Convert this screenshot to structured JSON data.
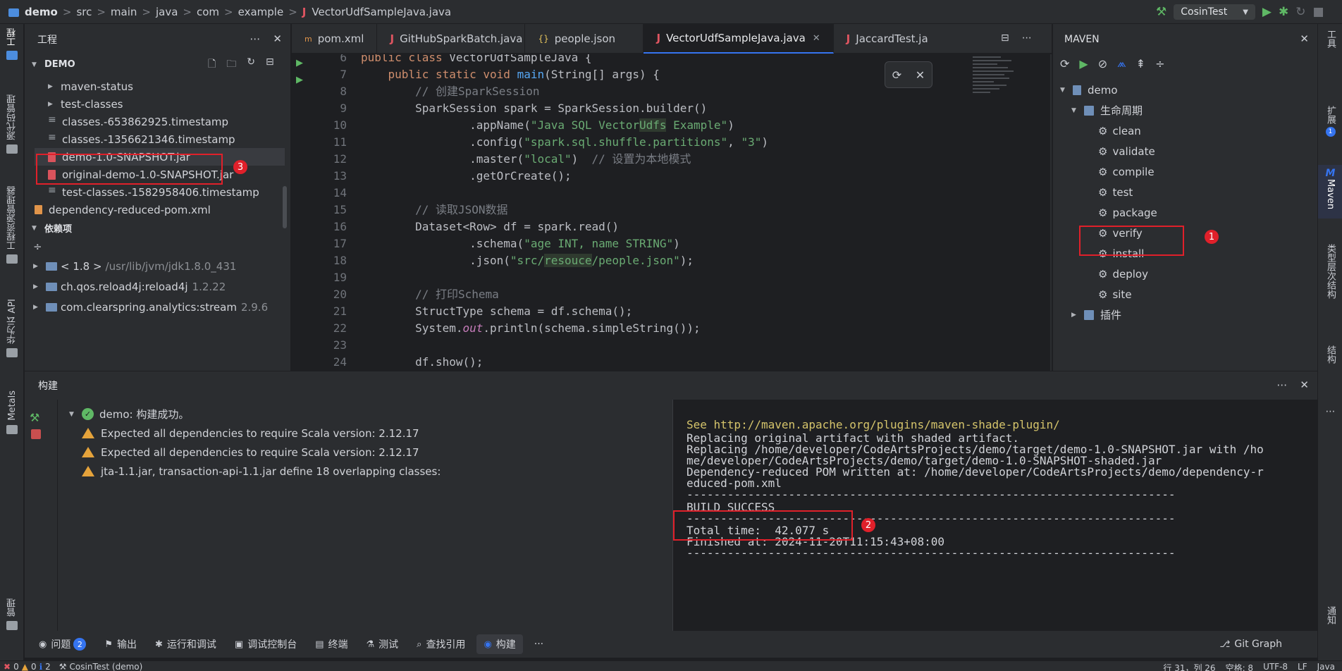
{
  "titlebar": {
    "crumbs": [
      "demo",
      "src",
      "main",
      "java",
      "com",
      "example",
      "VectorUdfSampleJava.java"
    ],
    "run_config": "CosinTest"
  },
  "left_strip": {
    "tabs": [
      "工程",
      "源代码管理",
      "工程资源管理器",
      "华为云 API",
      "Metals",
      "管理"
    ]
  },
  "right_strip": {
    "tabs": [
      "工具",
      "扩展",
      "Maven",
      "类型层次结构",
      "结构",
      "通知"
    ],
    "extension_badge": "1"
  },
  "project": {
    "title": "工程",
    "root": "DEMO",
    "items": [
      {
        "label": "maven-status",
        "kind": "folder"
      },
      {
        "label": "test-classes",
        "kind": "folder"
      },
      {
        "label": "classes.-653862925.timestamp",
        "kind": "file"
      },
      {
        "label": "classes.-1356621346.timestamp",
        "kind": "file"
      },
      {
        "label": "demo-1.0-SNAPSHOT.jar",
        "kind": "jar"
      },
      {
        "label": "original-demo-1.0-SNAPSHOT.jar",
        "kind": "jar"
      },
      {
        "label": "test-classes.-1582958406.timestamp",
        "kind": "file"
      },
      {
        "label": "dependency-reduced-pom.xml",
        "kind": "xml"
      }
    ],
    "deps_title": "依赖项",
    "deps": [
      {
        "label": "< 1.8 >",
        "detail": "/usr/lib/jvm/jdk1.8.0_431"
      },
      {
        "label": "ch.qos.reload4j:reload4j",
        "detail": "1.2.22"
      },
      {
        "label": "com.clearspring.analytics:stream",
        "detail": "2.9.6"
      }
    ]
  },
  "editor": {
    "tabs": [
      "pom.xml",
      "GitHubSparkBatch.java",
      "people.json",
      "VectorUdfSampleJava.java",
      "JaccardTest.ja"
    ],
    "active_tab": "VectorUdfSampleJava.java",
    "lines": [
      {
        "n": "6"
      },
      {
        "n": "7"
      },
      {
        "n": "8"
      },
      {
        "n": "9"
      },
      {
        "n": "10"
      },
      {
        "n": "11"
      },
      {
        "n": "12"
      },
      {
        "n": "13"
      },
      {
        "n": "14"
      },
      {
        "n": "15"
      },
      {
        "n": "16"
      },
      {
        "n": "17"
      },
      {
        "n": "18"
      },
      {
        "n": "19"
      },
      {
        "n": "20"
      },
      {
        "n": "21"
      },
      {
        "n": "22"
      },
      {
        "n": "23"
      },
      {
        "n": "24"
      }
    ],
    "code": {
      "l6a": "public class ",
      "l6b": "VectorUdfSampleJava {",
      "l7a": "    public static void ",
      "l7b": "main",
      "l7c": "(String[] args) {",
      "l8": "        // 创建SparkSession",
      "l9": "        SparkSession spark = SparkSession.builder()",
      "l10a": "                .appName(",
      "l10b": "\"Java SQL Vector",
      "l10c": "Udfs",
      "l10d": " Example\"",
      "l10e": ")",
      "l11a": "                .config(",
      "l11b": "\"spark.sql.shuffle.partitions\"",
      "l11c": ", ",
      "l11d": "\"3\"",
      "l11e": ")",
      "l12a": "                .master(",
      "l12b": "\"local\"",
      "l12c": ")  ",
      "l12d": "// 设置为本地模式",
      "l13": "                .getOrCreate();",
      "l15": "        // 读取JSON数据",
      "l16": "        Dataset<Row> df = spark.read()",
      "l17a": "                .schema(",
      "l17b": "\"age INT, name STRING\"",
      "l17c": ")",
      "l18a": "                .json(",
      "l18b": "\"src/",
      "l18c": "resouce",
      "l18d": "/people.json\"",
      "l18e": ");",
      "l20": "        // 打印Schema",
      "l21": "        StructType schema = df.schema();",
      "l22a": "        System.",
      "l22b": "out",
      "l22c": ".println(schema.simpleString());",
      "l24": "        df.show();"
    }
  },
  "maven": {
    "title": "MAVEN",
    "project": "demo",
    "lifecycle": "生命周期",
    "phases": [
      "clean",
      "validate",
      "compile",
      "test",
      "package",
      "verify",
      "install",
      "deploy",
      "site"
    ],
    "plugins": "插件"
  },
  "build": {
    "title": "构建",
    "status": "demo: 构建成功。",
    "warnings": [
      "Expected all dependencies to require Scala version: 2.12.17",
      "Expected all dependencies to require Scala version: 2.12.17",
      "jta-1.1.jar, transaction-api-1.1.jar define 18 overlapping classes:"
    ],
    "console": [
      "See http://maven.apache.org/plugins/maven-shade-plugin/",
      "Replacing original artifact with shaded artifact.",
      "Replacing /home/developer/CodeArtsProjects/demo/target/demo-1.0-SNAPSHOT.jar with /ho",
      "me/developer/CodeArtsProjects/demo/target/demo-1.0-SNAPSHOT-shaded.jar",
      "Dependency-reduced POM written at: /home/developer/CodeArtsProjects/demo/dependency-r",
      "educed-pom.xml",
      "------------------------------------------------------------------------",
      "BUILD SUCCESS",
      "------------------------------------------------------------------------",
      "Total time:  42.077 s",
      "Finished at: 2024-11-20T11:15:43+08:00",
      "------------------------------------------------------------------------"
    ]
  },
  "bottom_tabs": {
    "items": [
      "问题",
      "输出",
      "运行和调试",
      "调试控制台",
      "终端",
      "测试",
      "查找引用",
      "构建"
    ],
    "problems_count": "2",
    "more": "···",
    "git_graph": "Git Graph"
  },
  "statusbar": {
    "errors": "0",
    "warnings": "0",
    "infos": "2",
    "run_config": "CosinTest (demo)",
    "position": "行 31，列 26",
    "indent": "空格: 8",
    "encoding": "UTF-8",
    "eol": "LF",
    "language": "Java"
  },
  "annotations": [
    "1",
    "2",
    "3"
  ],
  "colors": {
    "accent": "#3574f0",
    "annotation_red": "#e0202a",
    "success": "#5fb865",
    "warning": "#e5a33b"
  }
}
